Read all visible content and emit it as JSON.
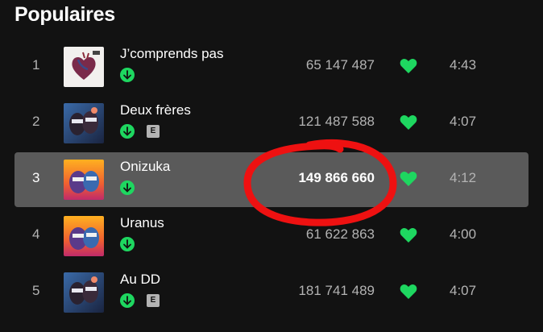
{
  "section": {
    "title": "Populaires"
  },
  "colors": {
    "accent": "#1ed760",
    "selected_row": "#5a5a5a",
    "annotation": "#ee1111"
  },
  "tracks": [
    {
      "index": "1",
      "title": "J’comprends pas",
      "plays": "65 147 487",
      "duration": "4:43",
      "explicit": false,
      "downloaded": true,
      "liked": true,
      "cover": "heart-cover"
    },
    {
      "index": "2",
      "title": "Deux frères",
      "plays": "121 487 588",
      "duration": "4:07",
      "explicit": true,
      "explicit_label": "E",
      "downloaded": true,
      "liked": true,
      "cover": "twins-cover"
    },
    {
      "index": "3",
      "title": "Onizuka",
      "plays": "149 866 660",
      "duration": "4:12",
      "explicit": false,
      "downloaded": true,
      "liked": true,
      "selected": true,
      "cover": "sunset-cover"
    },
    {
      "index": "4",
      "title": "Uranus",
      "plays": "61 622 863",
      "duration": "4:00",
      "explicit": false,
      "downloaded": true,
      "liked": true,
      "cover": "sunset-cover"
    },
    {
      "index": "5",
      "title": "Au DD",
      "plays": "181 741 489",
      "duration": "4:07",
      "explicit": true,
      "explicit_label": "E",
      "downloaded": true,
      "liked": true,
      "cover": "twins-cover"
    }
  ]
}
